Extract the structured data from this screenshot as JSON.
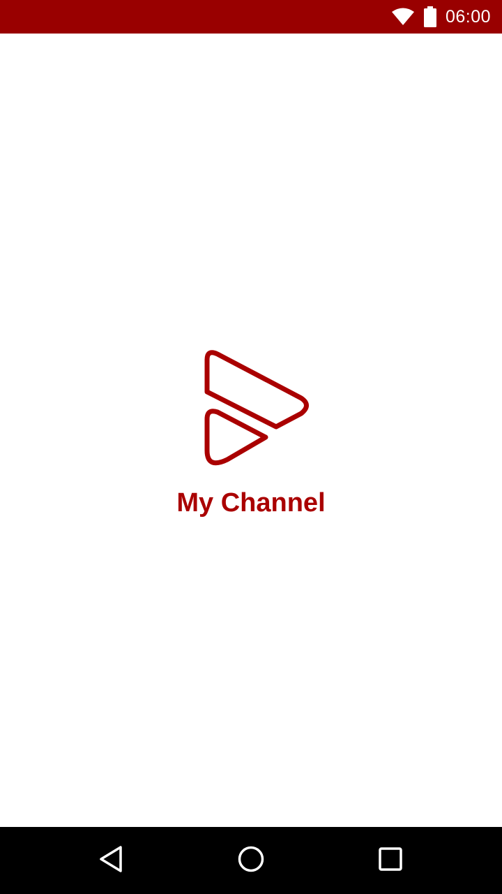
{
  "status_bar": {
    "time": "06:00",
    "icons": [
      "wifi-icon",
      "battery-icon"
    ]
  },
  "splash": {
    "app_name": "My Channel",
    "logo_icon": "play-logo-icon"
  },
  "nav_bar": {
    "buttons": [
      "back-icon",
      "home-icon",
      "recents-icon"
    ]
  },
  "colors": {
    "status_bar": "#990000",
    "brand": "#aa0000",
    "nav_bar": "#000000",
    "background": "#ffffff"
  }
}
